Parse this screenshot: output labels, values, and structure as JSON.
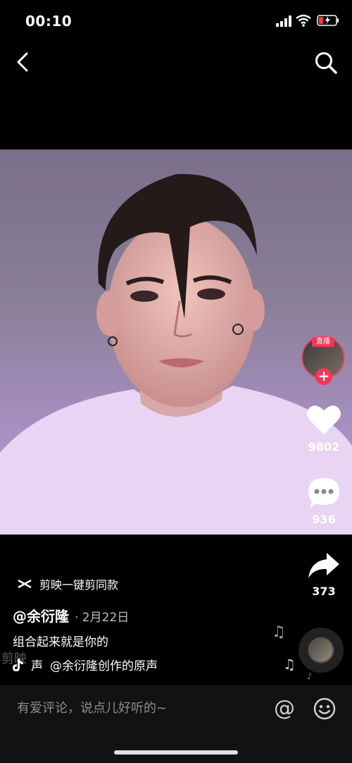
{
  "status": {
    "time": "00:10"
  },
  "rail": {
    "live_label": "直播",
    "follow_symbol": "+",
    "like_count": "9802",
    "comment_count": "936",
    "share_count": "373"
  },
  "info": {
    "capcut_label": "剪映一键剪同款",
    "author": "@余衍隆",
    "date": "· 2月22日",
    "caption": "组合起来就是你的",
    "sound_prefix": "声",
    "sound_text": "@余衍隆创作的原声",
    "watermark": "剪映"
  },
  "comment_bar": {
    "placeholder": "有爱评论，说点儿好听的~",
    "at_symbol": "@"
  },
  "icons": [
    "back-arrow",
    "search",
    "heart",
    "comment-bubble",
    "share-arrow",
    "capcut-logo",
    "tiktok-logo",
    "music-note",
    "emoji-smile",
    "signal",
    "wifi",
    "battery"
  ],
  "colors": {
    "accent": "#f2375a",
    "background": "#000000"
  }
}
